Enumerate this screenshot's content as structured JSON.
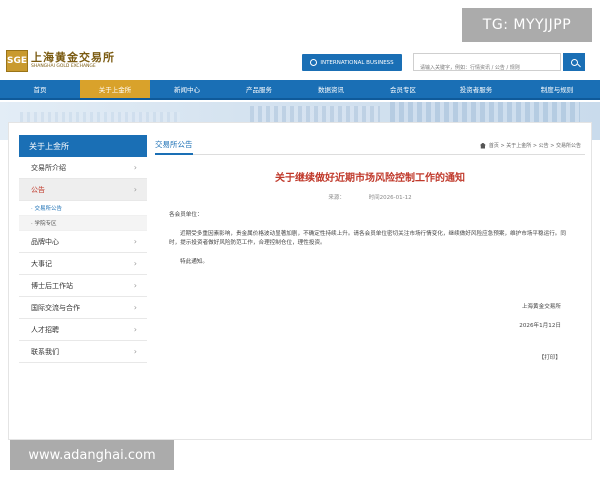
{
  "watermarks": {
    "top_right": "TG: MYYJJPP",
    "bottom_left": "www.adanghai.com"
  },
  "header": {
    "logo_cn": "上海黄金交易所",
    "logo_en": "SHANGHAI GOLD EXCHANGE",
    "logo_mark": "SGE",
    "intl_button": "INTERNATIONAL BUSINESS",
    "search_placeholder": "请输入关键字，例如：行情资讯 / 公告 / 规则"
  },
  "nav": [
    "首页",
    "关于上金所",
    "新闻中心",
    "产品服务",
    "数据资讯",
    "会员专区",
    "投资者服务",
    "制度与规则"
  ],
  "nav_active_index": 1,
  "sidebar": {
    "title": "关于上金所",
    "items": [
      {
        "label": "交易所介绍",
        "active": false
      },
      {
        "label": "公告",
        "active": true
      },
      {
        "label": "品牌中心",
        "active": false
      },
      {
        "label": "大事记",
        "active": false
      },
      {
        "label": "博士后工作站",
        "active": false
      },
      {
        "label": "国际交流与合作",
        "active": false
      },
      {
        "label": "人才招聘",
        "active": false
      },
      {
        "label": "联系我们",
        "active": false
      }
    ],
    "sub_items": [
      "交易所公告",
      "学院专区"
    ]
  },
  "content": {
    "tab": "交易所公告",
    "breadcrumb": "首页 > 关于上金所 > 公告 > 交易所公告",
    "title": "关于继续做好近期市场风险控制工作的通知",
    "meta_source": "来源：",
    "meta_date": "时间2026-01-12",
    "salutation": "各会员单位：",
    "paragraph": "近期受多重因素影响，贵金属价格波动显著加剧，不确定性持续上升。请各会员单位密切关注市场行情变化，继续做好风险应急预案，维护市场平稳运行。同时，提示投资者做好风险防范工作，合理控制仓位，理性投资。",
    "closing": "特此通知。",
    "signature": "上海黄金交易所",
    "date": "2026年1月12日",
    "print": "【打印】"
  },
  "colors": {
    "brand_blue": "#1a6fb5",
    "accent_gold": "#d9a22b",
    "title_red": "#c0392b"
  }
}
